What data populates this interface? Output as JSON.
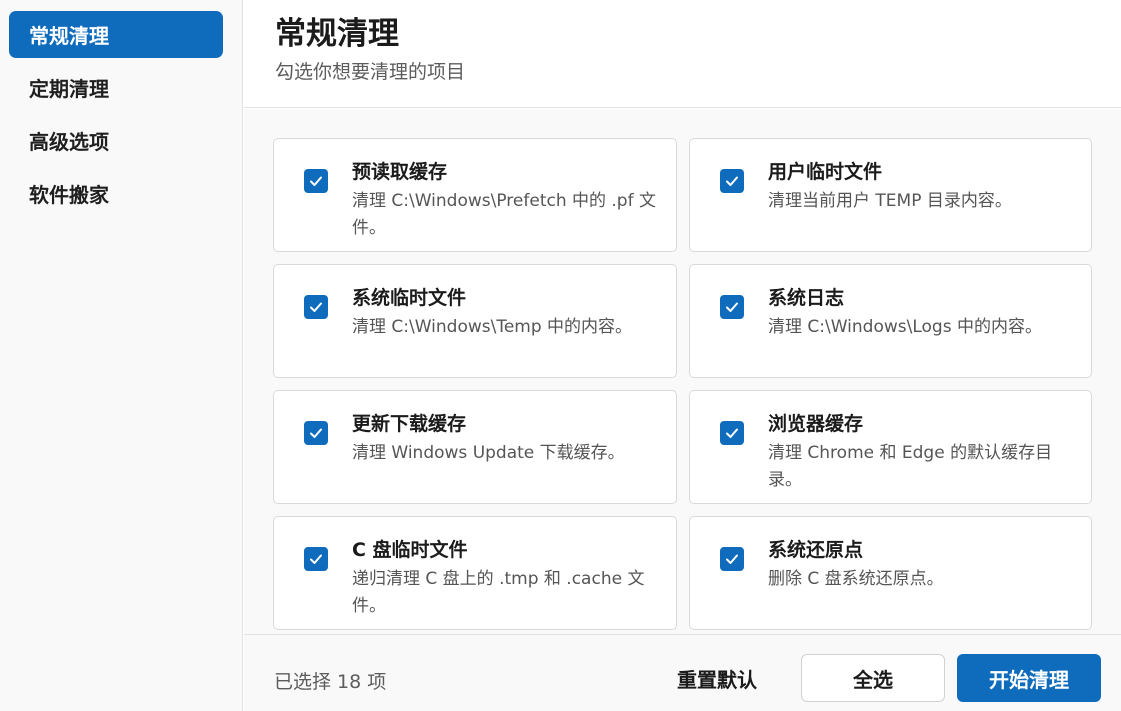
{
  "sidebar": {
    "items": [
      {
        "label": "常规清理"
      },
      {
        "label": "定期清理"
      },
      {
        "label": "高级选项"
      },
      {
        "label": "软件搬家"
      }
    ]
  },
  "header": {
    "title": "常规清理",
    "subtitle": "勾选你想要清理的项目"
  },
  "cards": [
    {
      "title": "预读取缓存",
      "desc": "清理 C:\\Windows\\Prefetch 中的 .pf 文件。",
      "checked": true
    },
    {
      "title": "用户临时文件",
      "desc": "清理当前用户 TEMP 目录内容。",
      "checked": true
    },
    {
      "title": "系统临时文件",
      "desc": "清理 C:\\Windows\\Temp 中的内容。",
      "checked": true
    },
    {
      "title": "系统日志",
      "desc": "清理 C:\\Windows\\Logs 中的内容。",
      "checked": true
    },
    {
      "title": "更新下载缓存",
      "desc": "清理 Windows Update 下载缓存。",
      "checked": true
    },
    {
      "title": "浏览器缓存",
      "desc": "清理 Chrome 和 Edge 的默认缓存目录。",
      "checked": true
    },
    {
      "title": "C 盘临时文件",
      "desc": "递归清理 C 盘上的 .tmp 和 .cache 文件。",
      "checked": true
    },
    {
      "title": "系统还原点",
      "desc": "删除 C 盘系统还原点。",
      "checked": true
    }
  ],
  "footer": {
    "selected_count": "已选择 18 项",
    "reset_label": "重置默认",
    "select_all_label": "全选",
    "start_label": "开始清理"
  },
  "colors": {
    "accent": "#0f6cbd",
    "sidebar_bg": "#f9f9f9"
  },
  "icons": {
    "checkbox": "checkmark-icon"
  }
}
